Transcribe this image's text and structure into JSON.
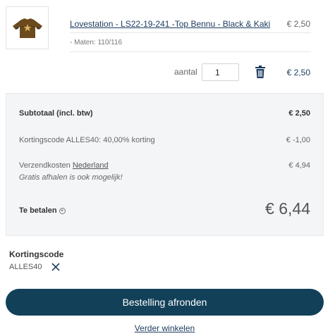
{
  "product": {
    "title": "Lovestation - LS22-19-241 -Top Bennu - Black & Kaki",
    "price": "€ 2,50",
    "size": "- Maten: 110/116",
    "quantity_label": "aantal",
    "quantity": "1",
    "line_total": "€ 2,50",
    "image_icon": "shirt-thumbnail",
    "image_color": "#6b4a1e"
  },
  "summary": {
    "subtotal_label": "Subtotaal (incl. btw)",
    "subtotal_value": "€ 2,50",
    "discount_label": "Kortingscode ALLES40: 40,00% korting",
    "discount_value": "€ -1,00",
    "shipping_prefix": "Verzendkosten",
    "shipping_country": "Nederland",
    "shipping_value": "€ 4,94",
    "pickup_note": "Gratis afhalen is ook mogelijk!",
    "total_label": "Te betalen",
    "total_value": "€ 6,44"
  },
  "discount": {
    "heading": "Kortingscode",
    "code": "ALLES40"
  },
  "actions": {
    "checkout_label": "Bestelling afronden",
    "continue_label": "Verder winkelen"
  },
  "colors": {
    "primary": "#124059",
    "link": "#1e3d61",
    "summary_bg": "#f4f5f7"
  }
}
